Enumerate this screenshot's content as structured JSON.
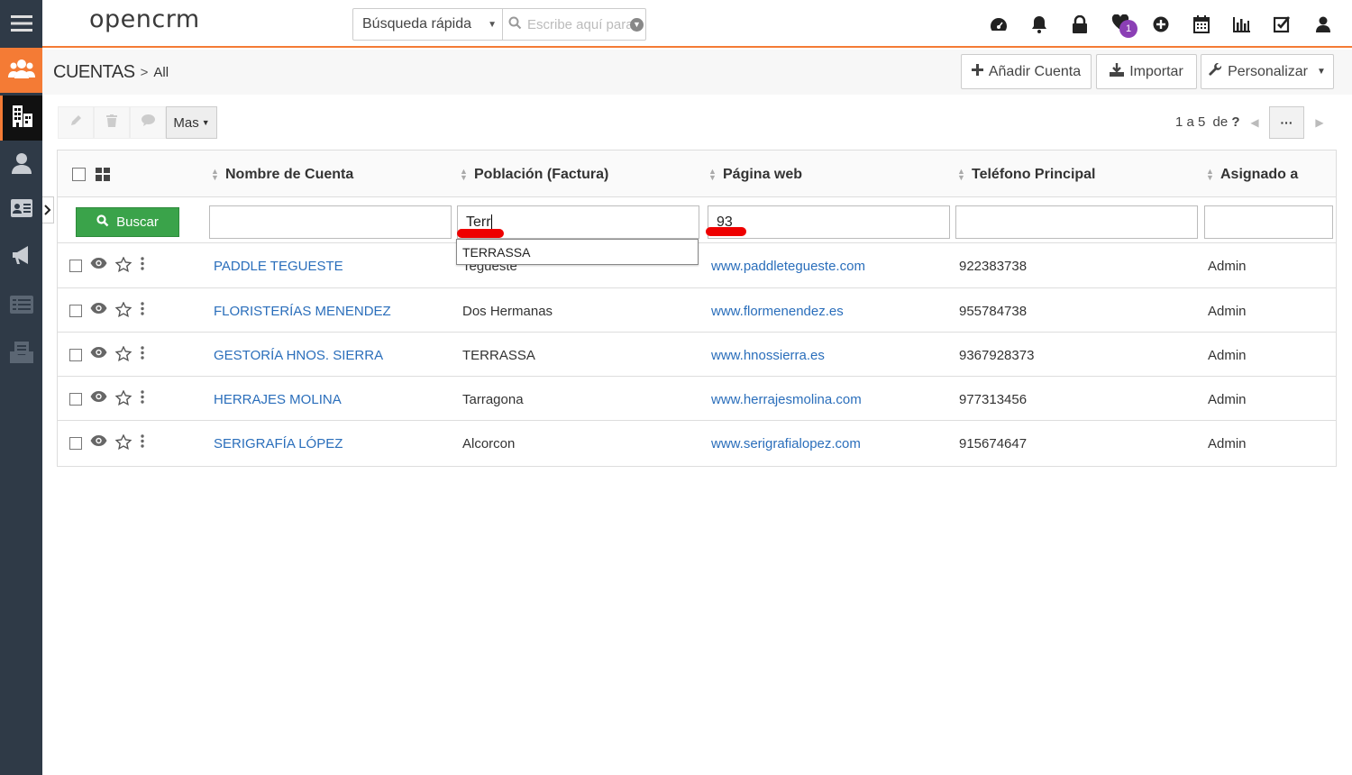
{
  "app": {
    "logo": "opencrm"
  },
  "quick_search": {
    "scope": "Búsqueda rápida",
    "placeholder": "Escribe aquí para"
  },
  "notifications": {
    "favorites_count": "1"
  },
  "header": {
    "module": "CUENTAS",
    "separator": ">",
    "view": "All",
    "add_label": "Añadir Cuenta",
    "import_label": "Importar",
    "customize_label": "Personalizar"
  },
  "toolbar": {
    "more_label": "Mas",
    "pager_range": "1 a 5",
    "pager_of": "de",
    "pager_total": "?",
    "pager_more": "···"
  },
  "columns": [
    "Nombre de Cuenta",
    "Población (Factura)",
    "Página web",
    "Teléfono Principal",
    "Asignado a"
  ],
  "filters": {
    "search_button": "Buscar",
    "name": "",
    "city": "Terr",
    "web": "93",
    "phone": "",
    "assigned": ""
  },
  "autocomplete": {
    "suggestion": "TERRASSA"
  },
  "rows": [
    {
      "name": "PADDLE TEGUESTE",
      "city": "Tegueste",
      "web": "www.paddletegueste.com",
      "phone": "922383738",
      "assigned": "Admin"
    },
    {
      "name": "FLORISTERÍAS MENENDEZ",
      "city": "Dos Hermanas",
      "web": "www.flormenendez.es",
      "phone": "955784738",
      "assigned": "Admin"
    },
    {
      "name": "GESTORÍA HNOS. SIERRA",
      "city": "TERRASSA",
      "web": "www.hnossierra.es",
      "phone": "9367928373",
      "assigned": "Admin"
    },
    {
      "name": "HERRAJES MOLINA",
      "city": "Tarragona",
      "web": "www.herrajesmolina.com",
      "phone": "977313456",
      "assigned": "Admin"
    },
    {
      "name": "SERIGRAFÍA LÓPEZ",
      "city": "Alcorcon",
      "web": "www.serigrafialopez.com",
      "phone": "915674647",
      "assigned": "Admin"
    }
  ],
  "colors": {
    "accent": "#f47b35",
    "sidebar": "#2f3a47",
    "link": "#2a6ebb",
    "search_button": "#3aa34a",
    "badge": "#8b3fb5",
    "annotation": "#e00000"
  }
}
